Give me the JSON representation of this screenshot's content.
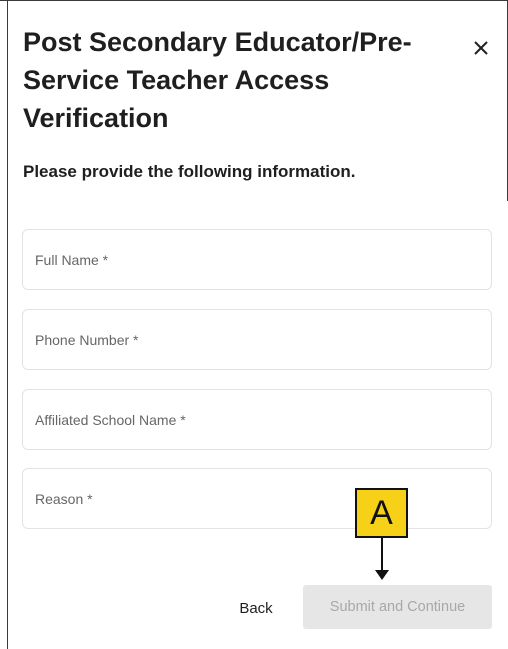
{
  "dialog": {
    "title": "Post Secondary Educator/Pre-Service Teacher Access Verification",
    "subtitle": "Please provide the following information."
  },
  "close_icon": "close-icon",
  "form": {
    "fields": [
      {
        "name": "full-name-field",
        "placeholder": "Full Name *",
        "value": ""
      },
      {
        "name": "phone-number-field",
        "placeholder": "Phone Number *",
        "value": ""
      },
      {
        "name": "affiliated-school-name-field",
        "placeholder": "Affiliated School Name *",
        "value": ""
      },
      {
        "name": "reason-field",
        "placeholder": "Reason *",
        "value": ""
      }
    ]
  },
  "actions": {
    "back_label": "Back",
    "submit_label": "Submit and Continue",
    "submit_disabled": true
  },
  "annotation": {
    "label": "A",
    "color": "#f7d117"
  },
  "colors": {
    "submit_bg": "#e6e6e6",
    "submit_text": "#a8a8a8",
    "field_border": "#e3e3e3"
  }
}
